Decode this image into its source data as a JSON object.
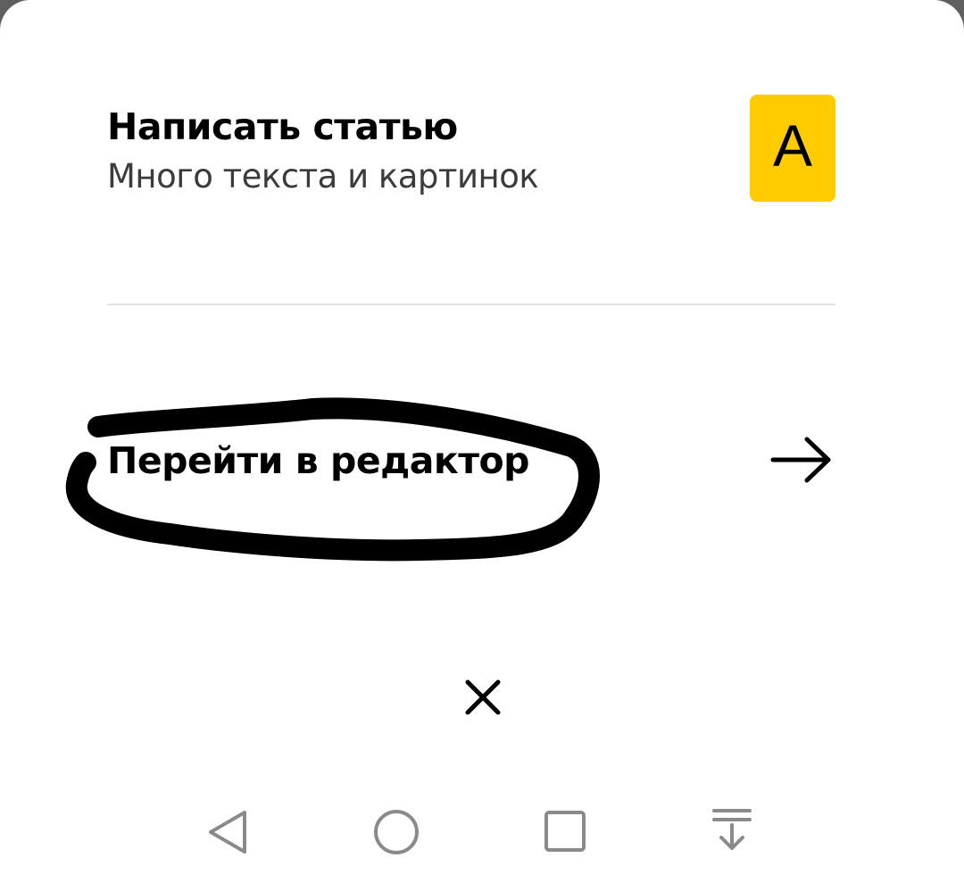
{
  "sheet": {
    "article_option": {
      "title": "Написать статью",
      "subtitle": "Много текста и картинок",
      "badge_letter": "A",
      "badge_color": "#ffcc00"
    },
    "editor_link": {
      "label": "Перейти в редактор",
      "icon": "arrow-right-icon"
    },
    "close_icon": "close-icon",
    "annotation": {
      "type": "hand-drawn-circle",
      "color": "#000000",
      "target": "editor_link"
    }
  },
  "nav_bar": {
    "items": [
      {
        "name": "back",
        "icon": "triangle-back-icon"
      },
      {
        "name": "home",
        "icon": "circle-home-icon"
      },
      {
        "name": "recents",
        "icon": "square-recents-icon"
      },
      {
        "name": "notifications",
        "icon": "pull-down-icon"
      }
    ],
    "icon_color": "#8a8a8a"
  }
}
